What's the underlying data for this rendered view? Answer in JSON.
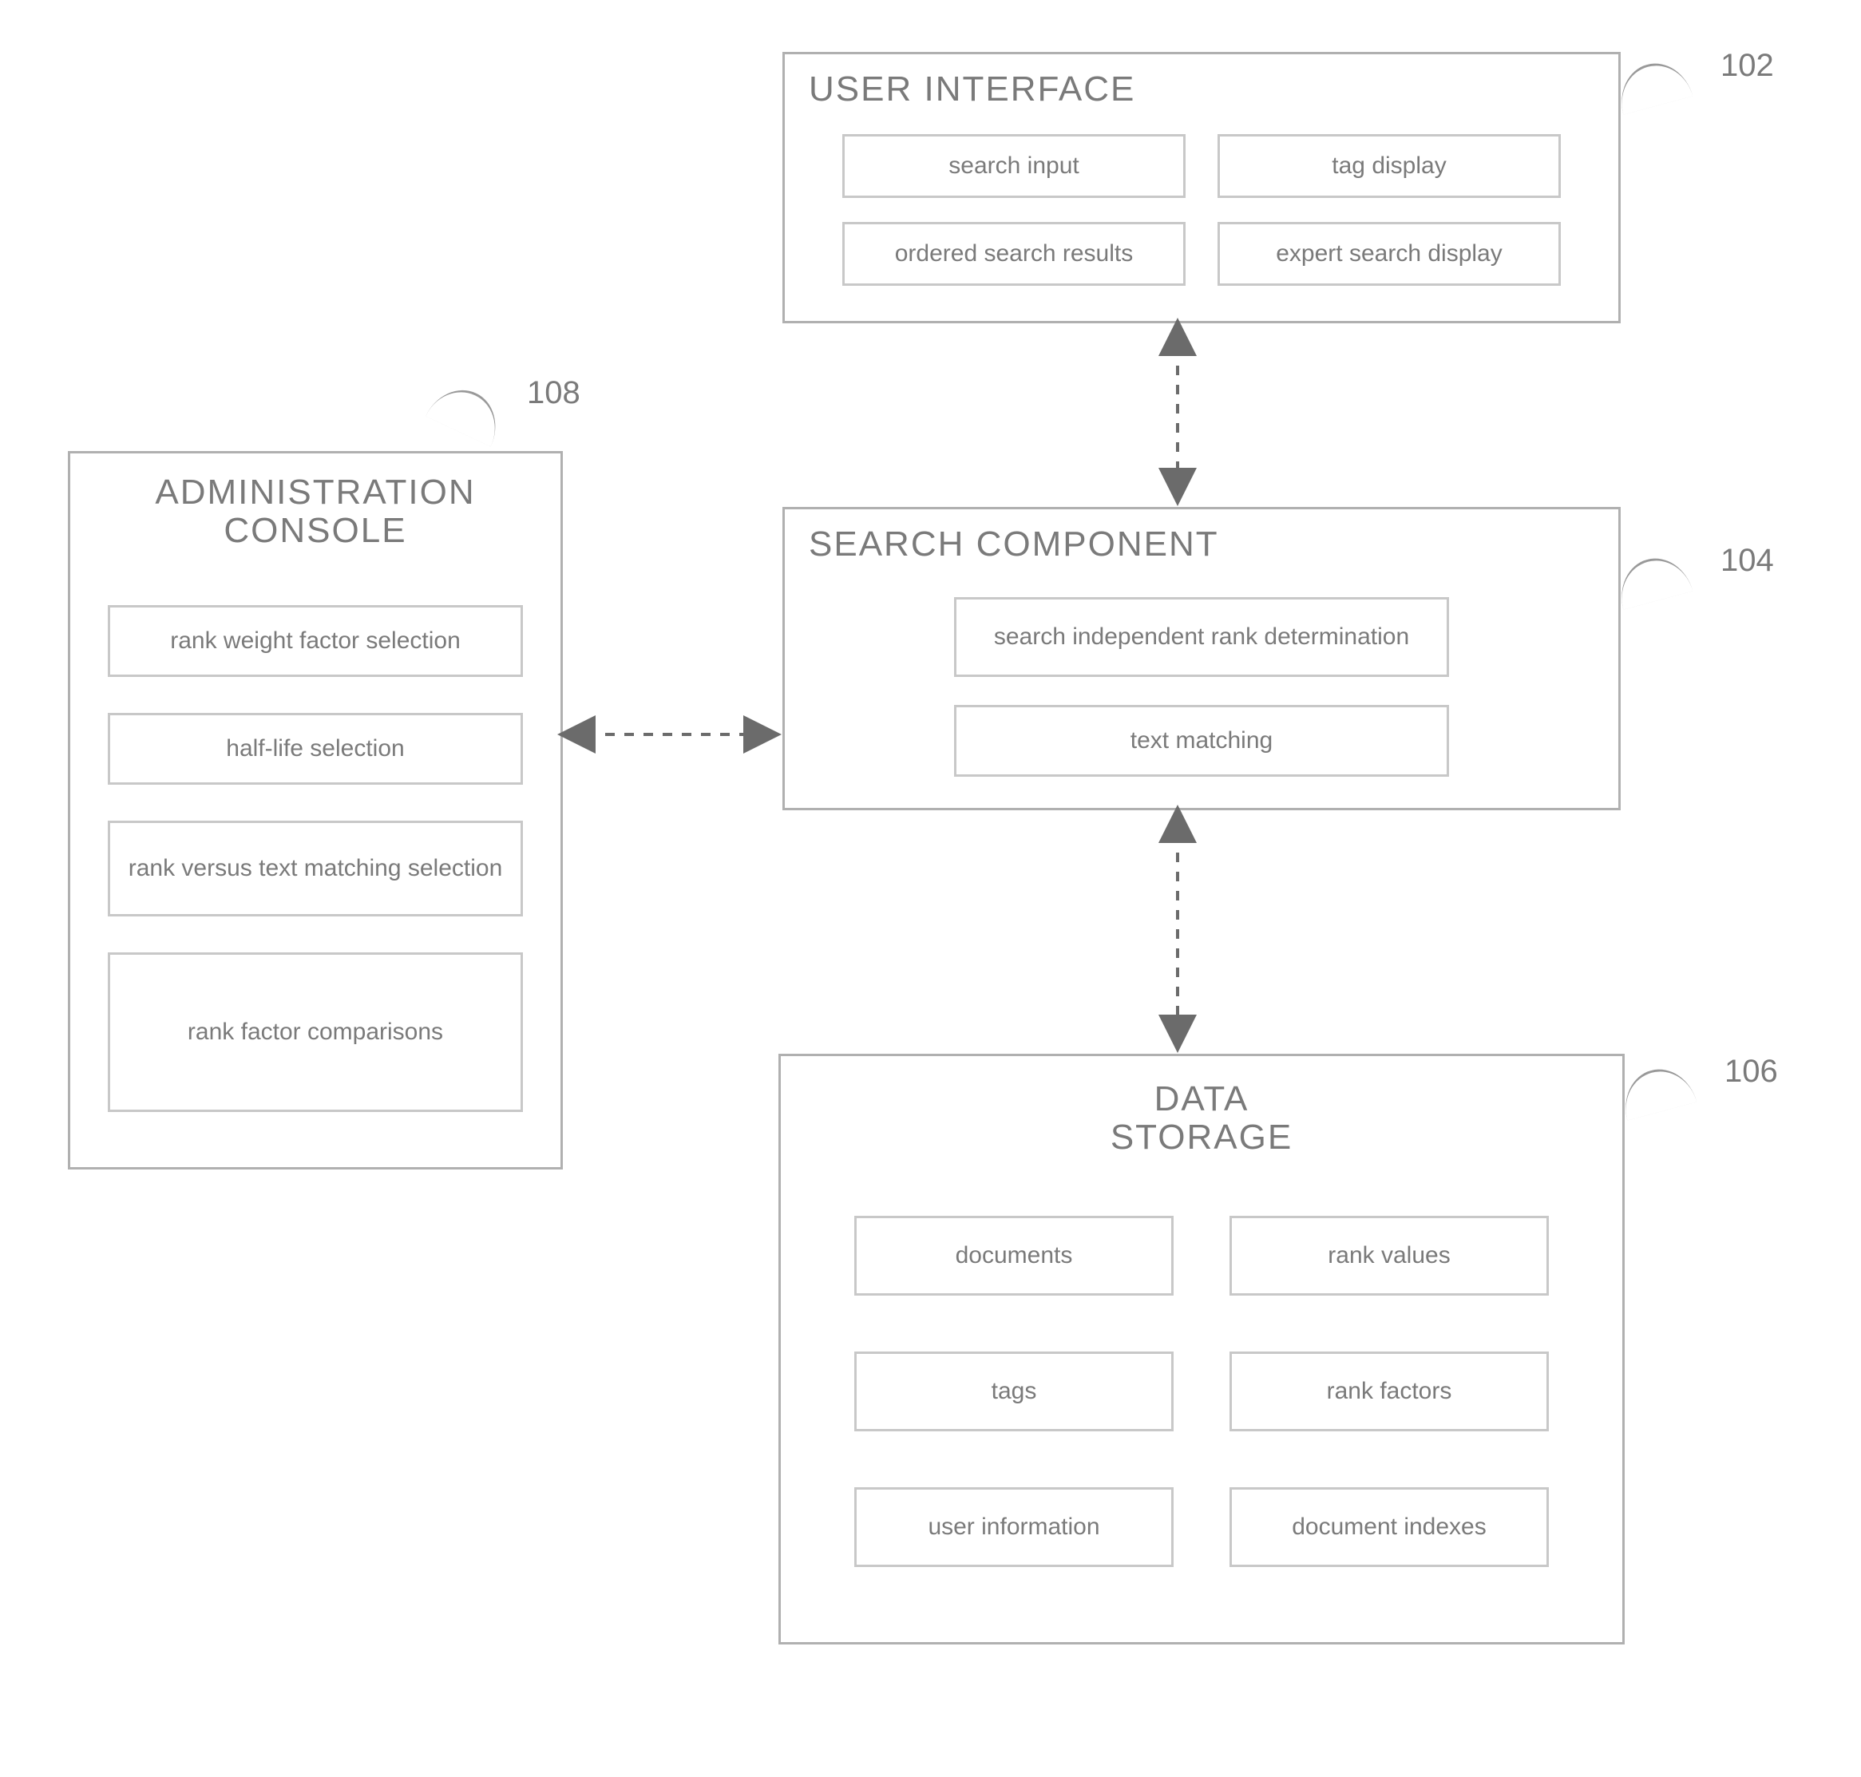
{
  "blocks": {
    "user_interface": {
      "title": "USER INTERFACE",
      "ref": "102",
      "items": [
        "search input",
        "tag display",
        "ordered search results",
        "expert search display"
      ]
    },
    "search_component": {
      "title": "SEARCH COMPONENT",
      "ref": "104",
      "items": [
        "search independent rank determination",
        "text matching"
      ]
    },
    "data_storage": {
      "title": "DATA\nSTORAGE",
      "ref": "106",
      "items": [
        "documents",
        "rank values",
        "tags",
        "rank factors",
        "user information",
        "document indexes"
      ]
    },
    "admin_console": {
      "title": "ADMINISTRATION\nCONSOLE",
      "ref": "108",
      "items": [
        "rank weight factor selection",
        "half-life selection",
        "rank versus text matching selection",
        "rank factor comparisons"
      ]
    }
  }
}
